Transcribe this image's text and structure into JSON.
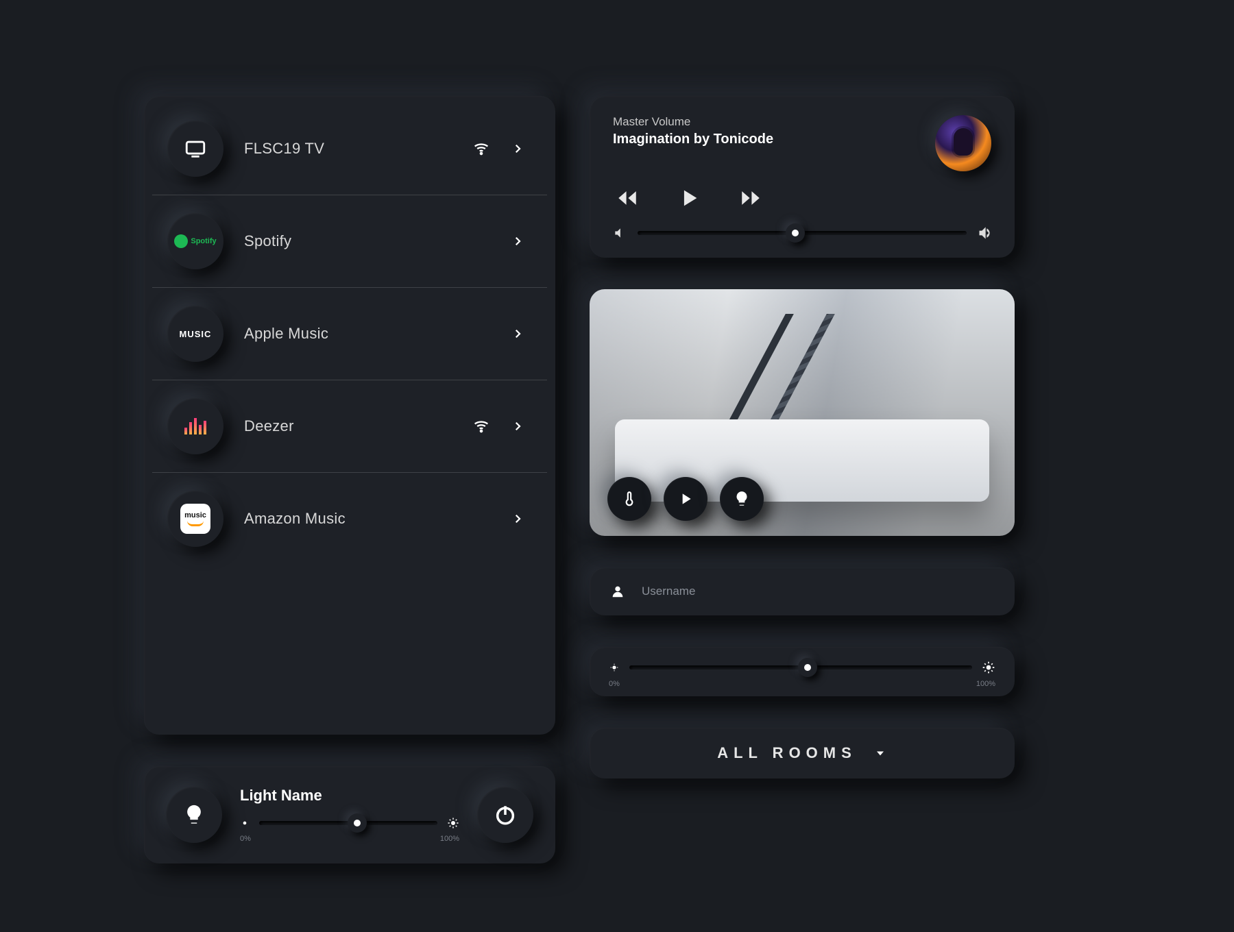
{
  "sources": {
    "items": [
      {
        "id": "tv",
        "label": "FLSC19 TV",
        "icon": "tv-icon",
        "wifi": true
      },
      {
        "id": "spotify",
        "label": "Spotify",
        "icon": "spotify-icon",
        "wifi": false
      },
      {
        "id": "apple",
        "label": "Apple Music",
        "icon": "apple-music-icon",
        "wifi": false
      },
      {
        "id": "deezer",
        "label": "Deezer",
        "icon": "deezer-icon",
        "wifi": true
      },
      {
        "id": "amazon",
        "label": "Amazon Music",
        "icon": "amazon-music-icon",
        "wifi": false
      }
    ]
  },
  "light": {
    "title": "Light Name",
    "min_label": "0%",
    "max_label": "100%",
    "value_pct": 55
  },
  "player": {
    "subtitle": "Master Volume",
    "title": "Imagination by Tonicode",
    "volume_pct": 48
  },
  "camera": {
    "controls": [
      "thermometer-icon",
      "play-icon",
      "bulb-icon"
    ]
  },
  "username": {
    "placeholder": "Username"
  },
  "brightness": {
    "min_label": "0%",
    "max_label": "100%",
    "value_pct": 52
  },
  "rooms": {
    "label": "ALL ROOMS"
  },
  "colors": {
    "bg": "#1a1d22",
    "card": "#1e2127",
    "accent_spotify": "#1DB954",
    "accent_amazon": "#FF9900"
  }
}
